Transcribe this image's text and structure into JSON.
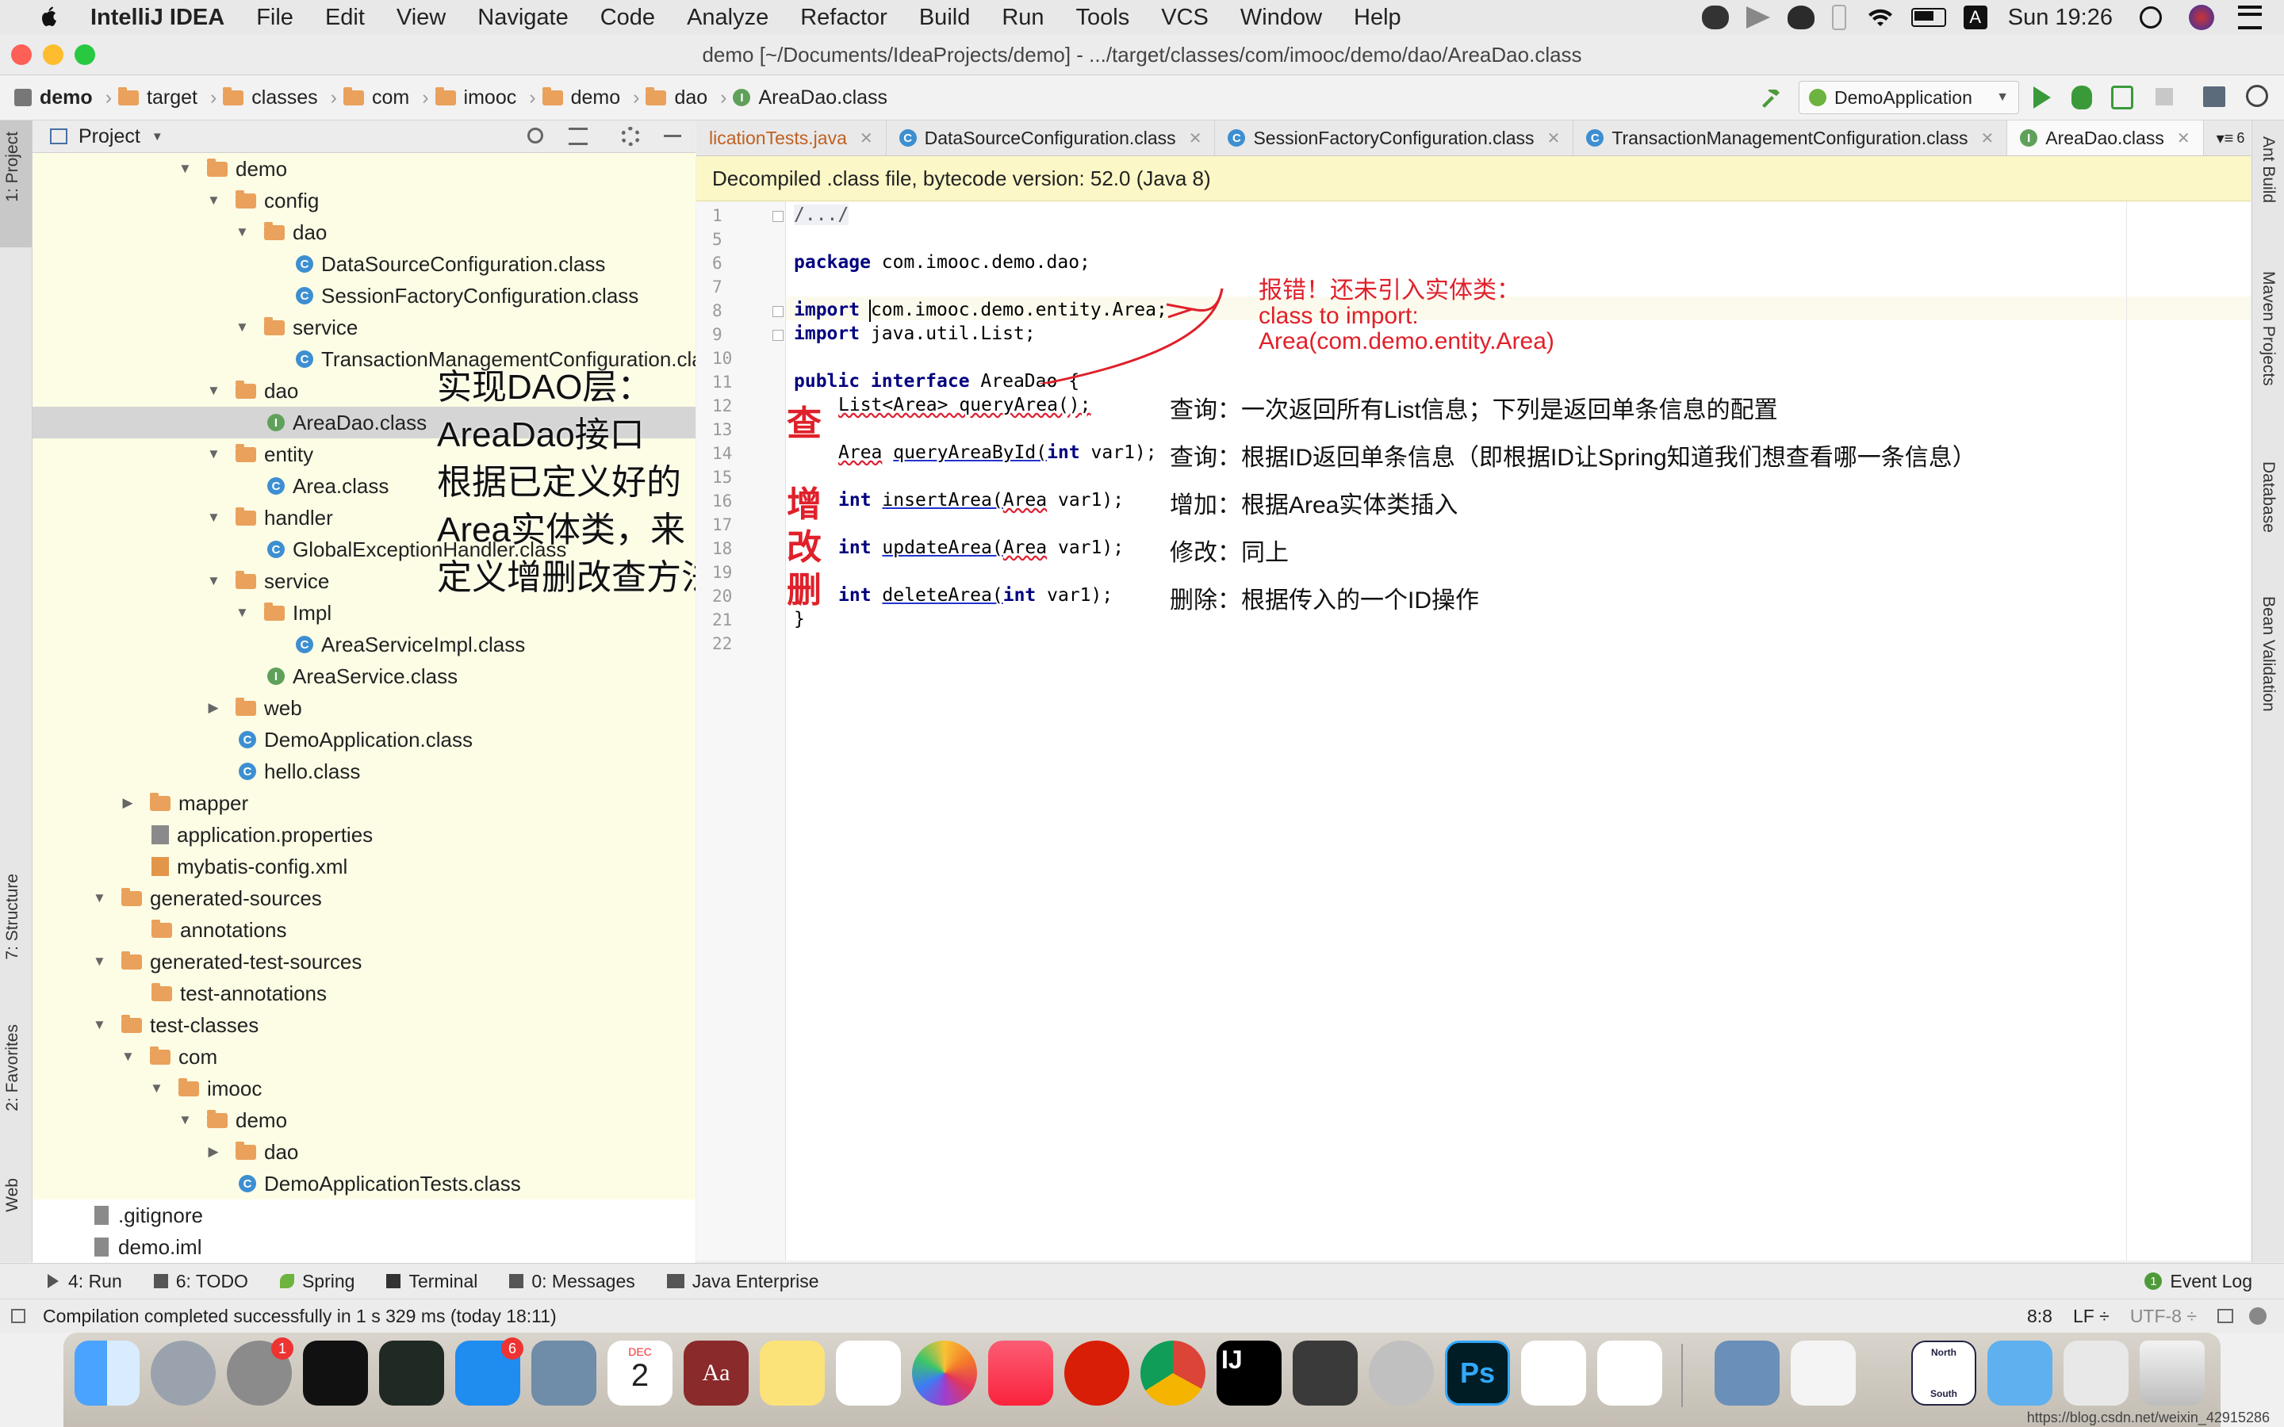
{
  "menubar": {
    "app": "IntelliJ IDEA",
    "items": [
      "File",
      "Edit",
      "View",
      "Navigate",
      "Code",
      "Analyze",
      "Refactor",
      "Build",
      "Run",
      "Tools",
      "VCS",
      "Window",
      "Help"
    ],
    "clock": "Sun 19:26",
    "input_method": "A"
  },
  "titlebar": {
    "title": "demo [~/Documents/IdeaProjects/demo] - .../target/classes/com/imooc/demo/dao/AreaDao.class"
  },
  "navbar": {
    "crumbs": [
      "demo",
      "target",
      "classes",
      "com",
      "imooc",
      "demo",
      "dao",
      "AreaDao.class"
    ],
    "run_config": "DemoApplication"
  },
  "project_panel": {
    "title": "Project",
    "tree": [
      {
        "label": "demo",
        "type": "folder",
        "expanded": true
      },
      {
        "label": "config",
        "type": "folder",
        "expanded": true
      },
      {
        "label": "dao",
        "type": "folder",
        "expanded": true
      },
      {
        "label": "DataSourceConfiguration.class",
        "type": "class"
      },
      {
        "label": "SessionFactoryConfiguration.class",
        "type": "class"
      },
      {
        "label": "service",
        "type": "folder",
        "expanded": true
      },
      {
        "label": "TransactionManagementConfiguration.class",
        "type": "class"
      },
      {
        "label": "dao",
        "type": "folder",
        "expanded": true
      },
      {
        "label": "AreaDao.class",
        "type": "interface",
        "selected": true
      },
      {
        "label": "entity",
        "type": "folder",
        "expanded": true
      },
      {
        "label": "Area.class",
        "type": "class"
      },
      {
        "label": "handler",
        "type": "folder",
        "expanded": true
      },
      {
        "label": "GlobalExceptionHandler.class",
        "type": "class"
      },
      {
        "label": "service",
        "type": "folder",
        "expanded": true
      },
      {
        "label": "Impl",
        "type": "folder",
        "expanded": true
      },
      {
        "label": "AreaServiceImpl.class",
        "type": "class"
      },
      {
        "label": "AreaService.class",
        "type": "interface"
      },
      {
        "label": "web",
        "type": "folder",
        "expanded": false
      },
      {
        "label": "DemoApplication.class",
        "type": "class"
      },
      {
        "label": "hello.class",
        "type": "class"
      },
      {
        "label": "mapper",
        "type": "folder",
        "expanded": false
      },
      {
        "label": "application.properties",
        "type": "file"
      },
      {
        "label": "mybatis-config.xml",
        "type": "file"
      },
      {
        "label": "generated-sources",
        "type": "folder",
        "expanded": true
      },
      {
        "label": "annotations",
        "type": "folder"
      },
      {
        "label": "generated-test-sources",
        "type": "folder",
        "expanded": true
      },
      {
        "label": "test-annotations",
        "type": "folder"
      },
      {
        "label": "test-classes",
        "type": "folder",
        "expanded": true
      },
      {
        "label": "com",
        "type": "folder",
        "expanded": true
      },
      {
        "label": "imooc",
        "type": "folder",
        "expanded": true
      },
      {
        "label": "demo",
        "type": "folder",
        "expanded": true
      },
      {
        "label": "dao",
        "type": "folder",
        "expanded": false
      },
      {
        "label": "DemoApplicationTests.class",
        "type": "class"
      },
      {
        "label": ".gitignore",
        "type": "file"
      },
      {
        "label": "demo.iml",
        "type": "file"
      }
    ]
  },
  "tabs": [
    {
      "label": "licationTests.java"
    },
    {
      "label": "DataSourceConfiguration.class"
    },
    {
      "label": "SessionFactoryConfiguration.class"
    },
    {
      "label": "TransactionManagementConfiguration.class"
    },
    {
      "label": "AreaDao.class",
      "active": true
    }
  ],
  "tabs_overflow": "6",
  "banner": "Decompiled .class file, bytecode version: 52.0 (Java 8)",
  "code": {
    "line_numbers": [
      "1",
      "5",
      "6",
      "7",
      "8",
      "9",
      "10",
      "11",
      "12",
      "13",
      "14",
      "15",
      "16",
      "17",
      "18",
      "19",
      "20",
      "21",
      "22"
    ],
    "collapsed": "/.../",
    "package": "package",
    "package_name": "com.imooc.demo.dao;",
    "import": "import",
    "import1": "com.imooc.demo.entity.Area;",
    "import2": "java.util.List;",
    "public_interface": "public interface",
    "iface_name": "AreaDao {",
    "m1": "List<Area> queryArea();",
    "m2_type": "Area",
    "m2": "queryAreaById(",
    "int": "int",
    "m2_rest": "var1);",
    "m3": "insertArea(",
    "m3_param": "Area",
    "m3_rest": "var1);",
    "m4": "updateArea(",
    "m4_param": "Area",
    "m4_rest": "var1);",
    "m5": "deleteArea(",
    "m5_rest": "var1);",
    "close": "}"
  },
  "annotations": {
    "error_title": "报错！还未引入实体类：",
    "error_line2": "class to import:",
    "error_line3": "Area(com.demo.entity.Area)",
    "query_label": "查",
    "cud_label_1": "增",
    "cud_label_2": "改",
    "cud_label_3": "删",
    "n1": "查询：一次返回所有List信息；下列是返回单条信息的配置",
    "n2": "查询：根据ID返回单条信息（即根据ID让Spring知道我们想查看哪一条信息）",
    "n3": "增加：根据Area实体类插入",
    "n4": "修改：同上",
    "n5": "删除：根据传入的一个ID操作",
    "overlay1": "实现DAO层：",
    "overlay2": "AreaDao接口",
    "overlay3": "根据已定义好的",
    "overlay4": "Area实体类，来",
    "overlay5": "定义增删改查方法"
  },
  "left_strip": [
    "1: Project",
    "7: Structure",
    "2: Favorites",
    "Web"
  ],
  "right_strip": [
    "Ant Build",
    "Maven Projects",
    "Database",
    "Bean Validation"
  ],
  "toolwindows": [
    {
      "label": "4: Run"
    },
    {
      "label": "6: TODO"
    },
    {
      "label": "Spring"
    },
    {
      "label": "Terminal"
    },
    {
      "label": "0: Messages"
    },
    {
      "label": "Java Enterprise"
    }
  ],
  "event_log": "Event Log",
  "event_count": "1",
  "status": {
    "message": "Compilation completed successfully in 1 s 329 ms (today 18:11)",
    "position": "8:8",
    "line_sep": "LF ÷",
    "encoding": "UTF-8 ÷"
  },
  "dock": {
    "calendar_month": "DEC",
    "calendar_day": "2",
    "sys_pref_badge": "1",
    "appstore_badge": "6",
    "dict_label": "Aa",
    "ij_label": "IJ",
    "ps_label": "Ps",
    "north": "North",
    "south": "South"
  },
  "watermark": "https://blog.csdn.net/weixin_42915286",
  "colors": {
    "annotation_red": "#e0202a",
    "keyword": "#000080",
    "tree_bg": "#fdfde6",
    "banner_bg": "#fcf7c7"
  }
}
